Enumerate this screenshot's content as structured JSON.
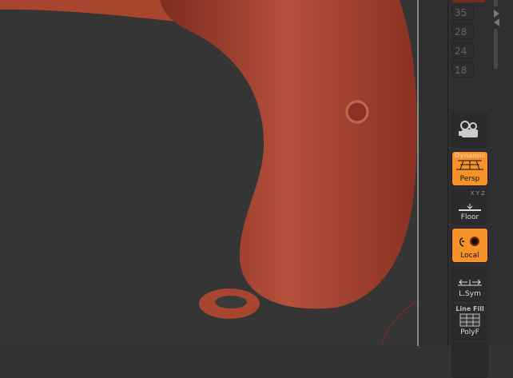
{
  "palette": {
    "model": "#a8412f",
    "accent": "#f7922a"
  },
  "sizes": [
    "35",
    "28",
    "24",
    "18"
  ],
  "buttons": {
    "camera": {
      "label": ""
    },
    "persp": {
      "top": "Dynamic",
      "label": "Persp",
      "active": true
    },
    "floor": {
      "axes": "X Y Z",
      "label": "Floor",
      "active": false
    },
    "local": {
      "label": "Local",
      "active": true
    },
    "lsym": {
      "label": "L.Sym",
      "active": false
    },
    "polyf": {
      "top": "Line Fill",
      "label": "PolyF",
      "active": false
    }
  }
}
